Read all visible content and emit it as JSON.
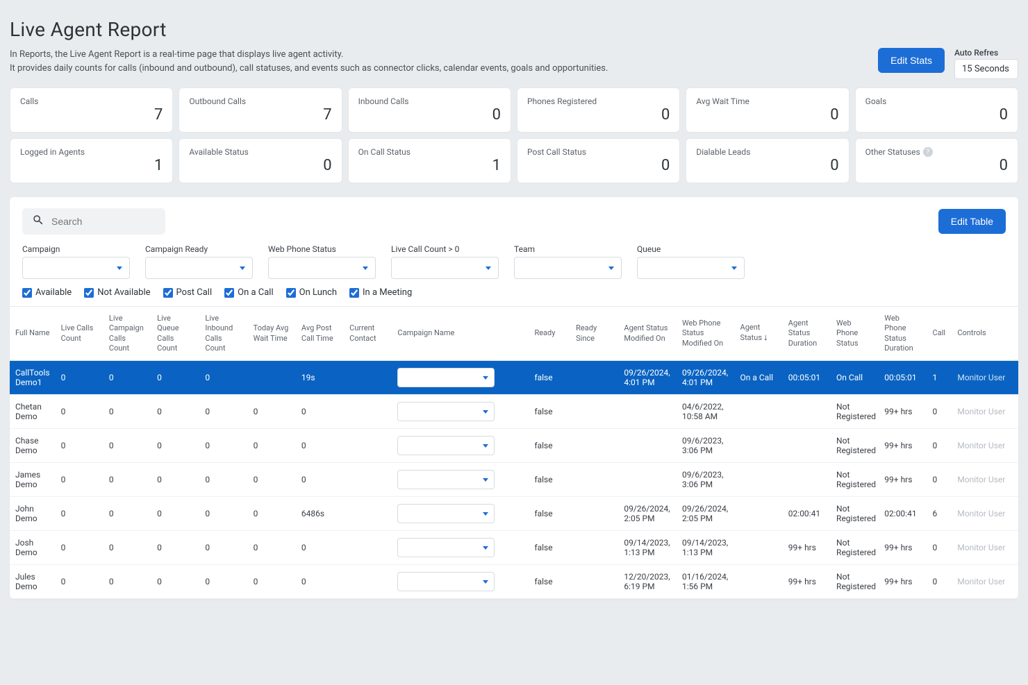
{
  "page": {
    "title": "Live Agent Report",
    "desc_line1": "In Reports, the Live Agent Report is a real-time page that displays live agent activity.",
    "desc_line2": "It provides daily counts for calls (inbound and outbound), call statuses, and events such as connector clicks, calendar events, goals and opportunities.",
    "edit_stats": "Edit Stats",
    "auto_refresh_label": "Auto Refres",
    "auto_refresh_value": "15 Seconds"
  },
  "cards_top": [
    {
      "label": "Calls",
      "value": "7"
    },
    {
      "label": "Outbound Calls",
      "value": "7"
    },
    {
      "label": "Inbound Calls",
      "value": "0"
    },
    {
      "label": "Phones Registered",
      "value": "0"
    },
    {
      "label": "Avg Wait Time",
      "value": "0"
    },
    {
      "label": "Goals",
      "value": "0"
    }
  ],
  "cards_bottom": [
    {
      "label": "Logged in Agents",
      "value": "1"
    },
    {
      "label": "Available Status",
      "value": "0"
    },
    {
      "label": "On Call Status",
      "value": "1"
    },
    {
      "label": "Post Call Status",
      "value": "0"
    },
    {
      "label": "Dialable Leads",
      "value": "0"
    },
    {
      "label": "Other Statuses",
      "value": "0",
      "help": true
    }
  ],
  "panel": {
    "search_placeholder": "Search",
    "edit_table": "Edit Table",
    "filters": [
      {
        "label": "Campaign"
      },
      {
        "label": "Campaign Ready"
      },
      {
        "label": "Web Phone Status"
      },
      {
        "label": "Live Call Count > 0"
      },
      {
        "label": "Team"
      },
      {
        "label": "Queue"
      }
    ],
    "checks": [
      {
        "label": "Available",
        "checked": true
      },
      {
        "label": "Not Available",
        "checked": true
      },
      {
        "label": "Post Call",
        "checked": true
      },
      {
        "label": "On a Call",
        "checked": true
      },
      {
        "label": "On Lunch",
        "checked": true
      },
      {
        "label": "In a Meeting",
        "checked": true
      }
    ]
  },
  "table": {
    "headers": [
      "Full Name",
      "Live Calls Count",
      "Live Campaign Calls Count",
      "Live Queue Calls Count",
      "Live Inbound Calls Count",
      "Today Avg Wait Time",
      "Avg Post Call Time",
      "Current Contact",
      "Campaign Name",
      "Ready",
      "Ready Since",
      "Agent Status Modified On",
      "Web Phone Status Modified On",
      "Agent Status",
      "Agent Status Duration",
      "Web Phone Status",
      "Web Phone Status Duration",
      "Call",
      "Controls"
    ],
    "sort_col": 13,
    "monitor_label": "Monitor User",
    "rows": [
      {
        "highlight": true,
        "name": "CallTools Demo1",
        "live_calls": "0",
        "live_camp": "0",
        "live_queue": "0",
        "live_inb": "0",
        "avg_wait": "",
        "avg_post": "19s",
        "contact": "",
        "ready": "false",
        "ready_since": "",
        "agent_mod": "09/26/2024, 4:01 PM",
        "web_mod": "09/26/2024, 4:01 PM",
        "agent_status": "On a Call",
        "agent_dur": "00:05:01",
        "web_status": "On Call",
        "web_dur": "00:05:01",
        "call": "1"
      },
      {
        "name": "Chetan Demo",
        "live_calls": "0",
        "live_camp": "0",
        "live_queue": "0",
        "live_inb": "0",
        "avg_wait": "0",
        "avg_post": "0",
        "contact": "",
        "ready": "false",
        "ready_since": "",
        "agent_mod": "",
        "web_mod": "04/6/2022, 10:58 AM",
        "agent_status": "",
        "agent_dur": "",
        "web_status": "Not Registered",
        "web_dur": "99+ hrs",
        "call": "0"
      },
      {
        "name": "Chase Demo",
        "live_calls": "0",
        "live_camp": "0",
        "live_queue": "0",
        "live_inb": "0",
        "avg_wait": "0",
        "avg_post": "0",
        "contact": "",
        "ready": "false",
        "ready_since": "",
        "agent_mod": "",
        "web_mod": "09/6/2023, 3:06 PM",
        "agent_status": "",
        "agent_dur": "",
        "web_status": "Not Registered",
        "web_dur": "99+ hrs",
        "call": "0"
      },
      {
        "name": "James Demo",
        "live_calls": "0",
        "live_camp": "0",
        "live_queue": "0",
        "live_inb": "0",
        "avg_wait": "0",
        "avg_post": "0",
        "contact": "",
        "ready": "false",
        "ready_since": "",
        "agent_mod": "",
        "web_mod": "09/6/2023, 3:06 PM",
        "agent_status": "",
        "agent_dur": "",
        "web_status": "Not Registered",
        "web_dur": "99+ hrs",
        "call": "0"
      },
      {
        "name": "John Demo",
        "live_calls": "0",
        "live_camp": "0",
        "live_queue": "0",
        "live_inb": "0",
        "avg_wait": "0",
        "avg_post": "6486s",
        "contact": "",
        "ready": "false",
        "ready_since": "",
        "agent_mod": "09/26/2024, 2:05 PM",
        "web_mod": "09/26/2024, 2:05 PM",
        "agent_status": "",
        "agent_dur": "02:00:41",
        "web_status": "Not Registered",
        "web_dur": "02:00:41",
        "call": "6"
      },
      {
        "name": "Josh Demo",
        "live_calls": "0",
        "live_camp": "0",
        "live_queue": "0",
        "live_inb": "0",
        "avg_wait": "0",
        "avg_post": "0",
        "contact": "",
        "ready": "false",
        "ready_since": "",
        "agent_mod": "09/14/2023, 1:13 PM",
        "web_mod": "09/14/2023, 1:13 PM",
        "agent_status": "",
        "agent_dur": "99+ hrs",
        "web_status": "Not Registered",
        "web_dur": "99+ hrs",
        "call": "0"
      },
      {
        "name": "Jules Demo",
        "live_calls": "0",
        "live_camp": "0",
        "live_queue": "0",
        "live_inb": "0",
        "avg_wait": "0",
        "avg_post": "0",
        "contact": "",
        "ready": "false",
        "ready_since": "",
        "agent_mod": "12/20/2023, 6:19 PM",
        "web_mod": "01/16/2024, 1:56 PM",
        "agent_status": "",
        "agent_dur": "99+ hrs",
        "web_status": "Not Registered",
        "web_dur": "99+ hrs",
        "call": "0"
      }
    ]
  }
}
